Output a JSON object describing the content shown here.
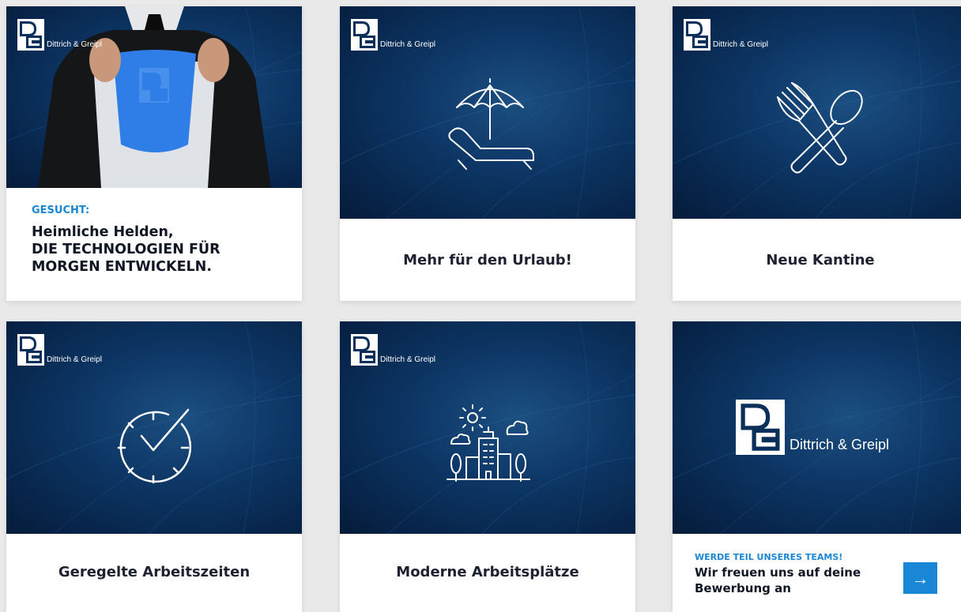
{
  "brand": {
    "name": "Dittrich & Greipl"
  },
  "cards": [
    {
      "kicker": "GESUCHT:",
      "headline_1": "Heimliche Helden,",
      "headline_2": "DIE TECHNOLOGIEN FÜR",
      "headline_3": "MORGEN ENTWICKELN.",
      "icon": "superhero-photo"
    },
    {
      "title": "Mehr für den Urlaub!",
      "icon": "beach-umbrella-lounger-icon"
    },
    {
      "title": "Neue Kantine",
      "icon": "fork-spoon-icon"
    },
    {
      "title": "Geregelte Arbeitszeiten",
      "icon": "clock-check-icon"
    },
    {
      "title": "Moderne Arbeitsplätze",
      "icon": "city-building-icon"
    },
    {
      "kicker": "WERDE TEIL UNSERES TEAMS!",
      "msg_1": "Wir freuen uns auf deine",
      "msg_2": "Bewerbung an",
      "button": "→",
      "icon": "arrow-right-icon"
    }
  ],
  "colors": {
    "navy": "#0d3766",
    "accent": "#1a86d6",
    "text": "#1d2230"
  }
}
